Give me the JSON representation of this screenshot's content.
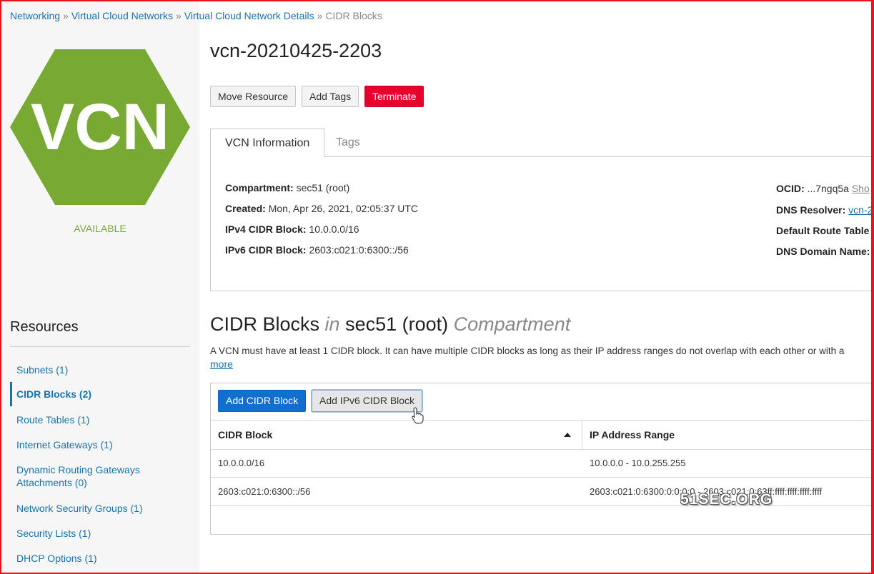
{
  "breadcrumb": {
    "items": [
      "Networking",
      "Virtual Cloud Networks",
      "Virtual Cloud Network Details",
      "CIDR Blocks"
    ],
    "separator": "»"
  },
  "logo": {
    "text": "VCN",
    "color": "#78a932"
  },
  "resource": {
    "status": "AVAILABLE",
    "title": "vcn-20210425-2203"
  },
  "actions": {
    "move": "Move Resource",
    "add_tags": "Add Tags",
    "terminate": "Terminate"
  },
  "tabs": [
    "VCN Information",
    "Tags"
  ],
  "info": {
    "left": [
      {
        "label": "Compartment:",
        "value": "sec51 (root)"
      },
      {
        "label": "Created:",
        "value": "Mon, Apr 26, 2021, 02:05:37 UTC"
      },
      {
        "label": "IPv4 CIDR Block:",
        "value": "10.0.0.0/16"
      },
      {
        "label": "IPv6 CIDR Block:",
        "value": "2603:c021:0:6300::/56"
      }
    ],
    "right": {
      "ocid_label": "OCID:",
      "ocid_value": "...7ngq5a",
      "ocid_show": "Sho",
      "dns_resolver_label": "DNS Resolver:",
      "dns_resolver_value": "vcn-2",
      "route_table_label": "Default Route Table",
      "dns_domain_label": "DNS Domain Name:"
    }
  },
  "resources": {
    "title": "Resources",
    "items": [
      "Subnets (1)",
      "CIDR Blocks (2)",
      "Route Tables (1)",
      "Internet Gateways (1)",
      "Dynamic Routing Gateways",
      "Attachments (0)",
      "Network Security Groups (1)",
      "Security Lists (1)",
      "DHCP Options (1)"
    ]
  },
  "section": {
    "title_main": "CIDR Blocks",
    "title_in": "in",
    "title_compartment": "sec51 (root)",
    "title_suffix": "Compartment",
    "description": "A VCN must have at least 1 CIDR block. It can have multiple CIDR blocks as long as their IP address ranges do not overlap with each other or with a",
    "more": "more"
  },
  "table": {
    "add_cidr": "Add CIDR Block",
    "add_ipv6": "Add IPv6 CIDR Block",
    "headers": [
      "CIDR Block",
      "IP Address Range"
    ],
    "rows": [
      [
        "10.0.0.0/16",
        "10.0.0.0 - 10.0.255.255"
      ],
      [
        "2603:c021:0:6300::/56",
        "2603:c021:0:6300:0:0:0:0 - 2603:c021:0:63ff:ffff:ffff:ffff:ffff"
      ]
    ]
  },
  "watermark": "51SEC.ORG"
}
